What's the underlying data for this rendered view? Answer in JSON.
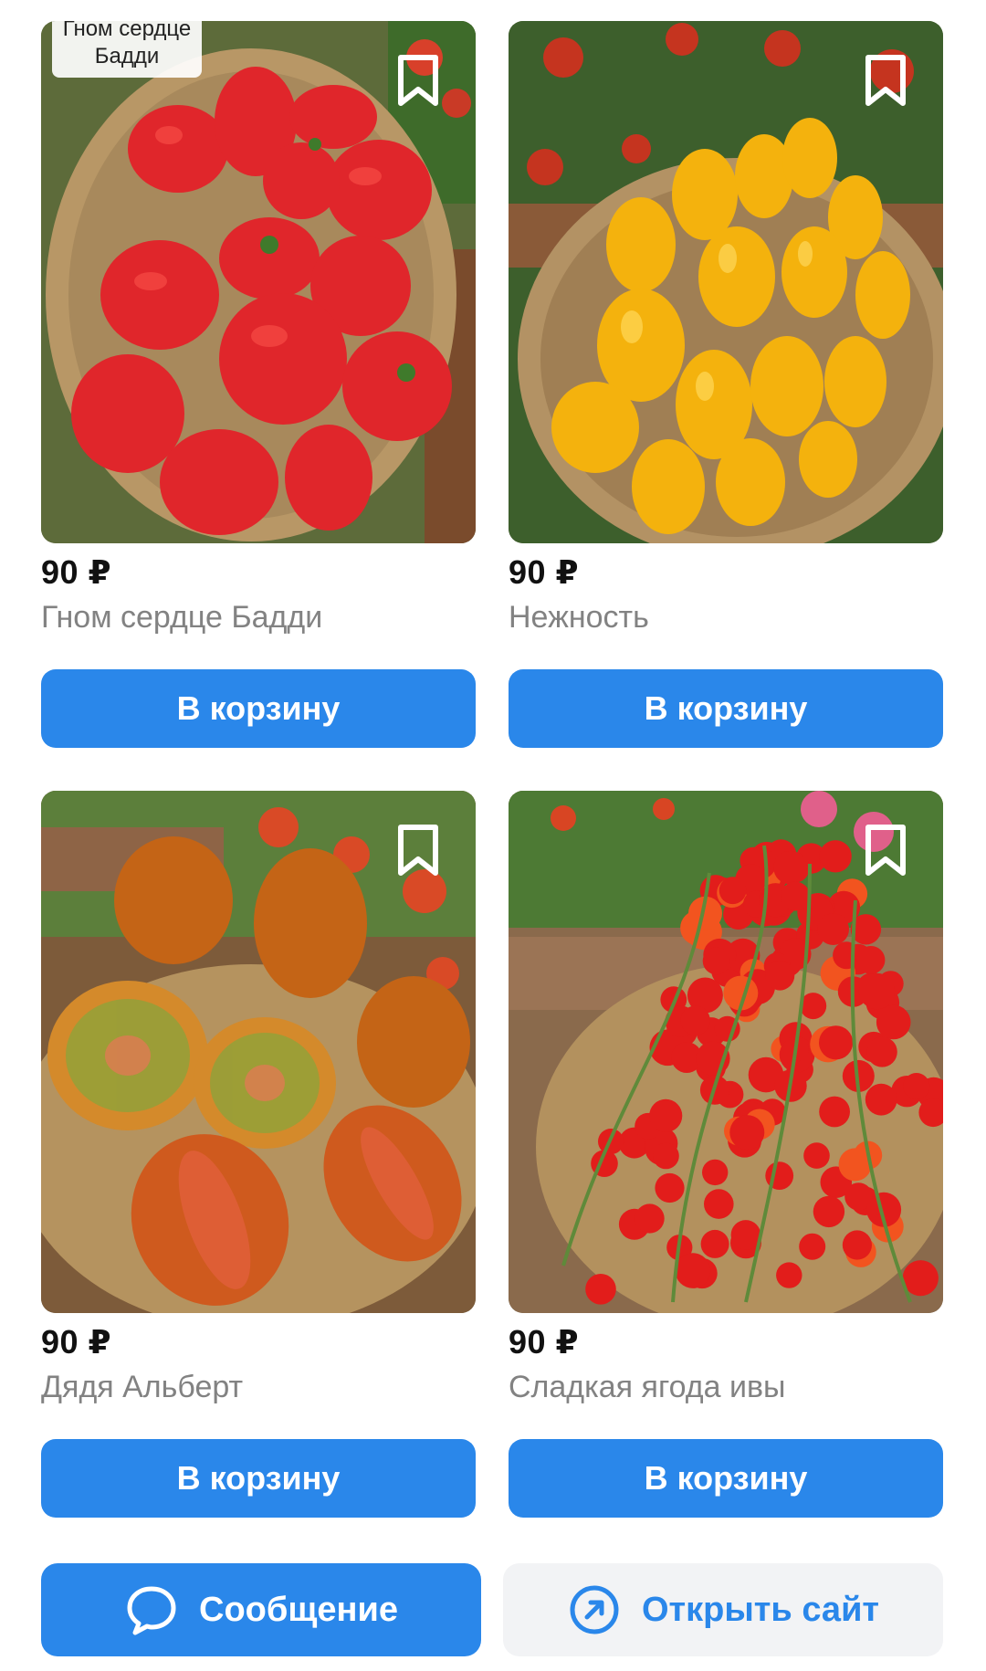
{
  "products": [
    {
      "image_label": "Гном сердце Бадди",
      "price": "90 ₽",
      "name": "Гном сердце Бадди",
      "cart_label": "В корзину",
      "icon": "bookmark-icon"
    },
    {
      "price": "90 ₽",
      "name": "Нежность",
      "cart_label": "В корзину",
      "icon": "bookmark-icon"
    },
    {
      "price": "90 ₽",
      "name": "Дядя Альберт",
      "cart_label": "В корзину",
      "icon": "bookmark-icon"
    },
    {
      "price": "90 ₽",
      "name": "Сладкая ягода ивы",
      "cart_label": "В корзину",
      "icon": "bookmark-icon"
    }
  ],
  "actions": {
    "message_label": "Сообщение",
    "message_icon": "chat-bubble-icon",
    "open_site_label": "Открыть сайт",
    "open_site_icon": "external-link-icon"
  },
  "colors": {
    "accent": "#2a87ea",
    "secondary_button_bg": "#f2f3f5",
    "name_text": "#828282"
  }
}
